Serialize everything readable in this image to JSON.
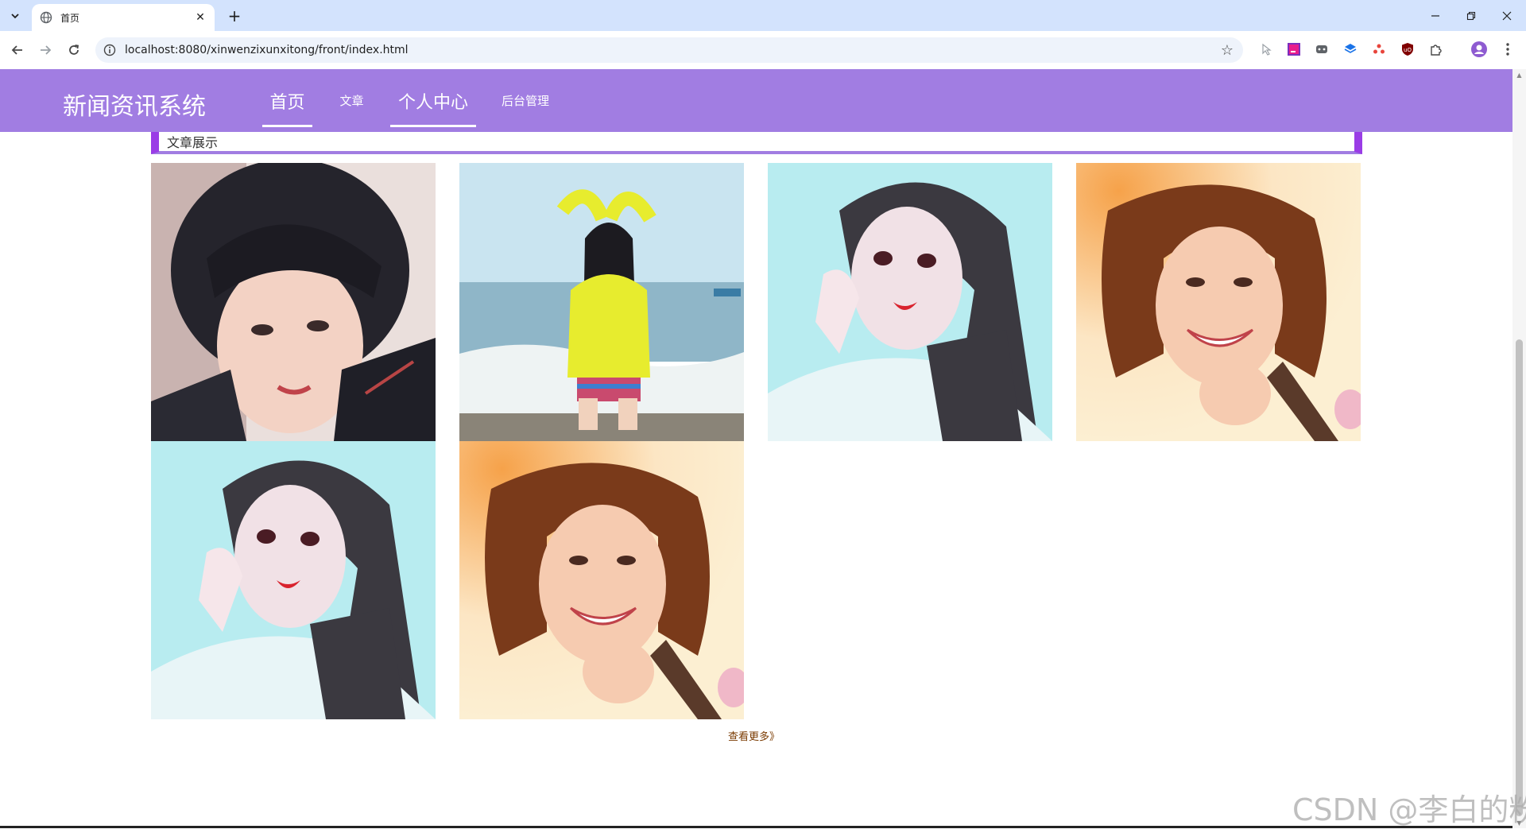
{
  "browser": {
    "tab_title": "首页",
    "url": "localhost:8080/xinwenzixunxitong/front/index.html"
  },
  "site": {
    "title": "新闻资讯系统",
    "nav": [
      {
        "label": "首页",
        "active": true
      },
      {
        "label": "文章",
        "active": false
      },
      {
        "label": "个人中心",
        "active": true
      },
      {
        "label": "后台管理",
        "active": false
      }
    ]
  },
  "section": {
    "title": "文章展示",
    "more_label": "查看更多》"
  },
  "gallery": [
    {
      "palette": [
        "#eadfdc",
        "#2b2a33",
        "#f3d2c4"
      ]
    },
    {
      "palette": [
        "#b9d9ea",
        "#e7ec2e",
        "#8aa7b8"
      ]
    },
    {
      "palette": [
        "#b8ecf0",
        "#3b3940",
        "#f1e1e6"
      ]
    },
    {
      "palette": [
        "#fcefd2",
        "#f6a24a",
        "#5a3a2a"
      ]
    },
    {
      "palette": [
        "#b8ecf0",
        "#3b3940",
        "#f1e1e6"
      ]
    },
    {
      "palette": [
        "#fcefd2",
        "#f6a24a",
        "#5a3a2a"
      ]
    }
  ],
  "watermark": "CSDN @李白的粉",
  "colors": {
    "header": "#a17de2",
    "accent": "#9a3ce6"
  }
}
